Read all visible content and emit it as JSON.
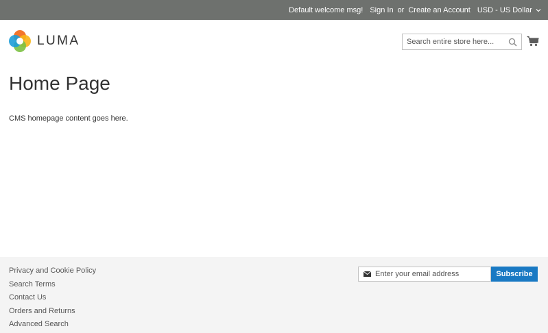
{
  "topbar": {
    "welcome": "Default welcome msg!",
    "sign_in": "Sign In",
    "or": "or",
    "create_account": "Create an Account",
    "currency": "USD - US Dollar",
    "background": "#6e716e"
  },
  "header": {
    "logo_text": "LUMA",
    "search_placeholder": "Search entire store here...",
    "search_icon": "search-icon",
    "cart_icon": "cart-icon"
  },
  "main": {
    "title": "Home Page",
    "content": "CMS homepage content goes here."
  },
  "footer": {
    "links": [
      "Privacy and Cookie Policy",
      "Search Terms",
      "Contact Us",
      "Orders and Returns",
      "Advanced Search"
    ],
    "newsletter": {
      "placeholder": "Enter your email address",
      "subscribe_label": "Subscribe",
      "envelope_icon": "envelope-icon",
      "button_color": "#1979c3"
    },
    "background": "#f4f4f4"
  }
}
